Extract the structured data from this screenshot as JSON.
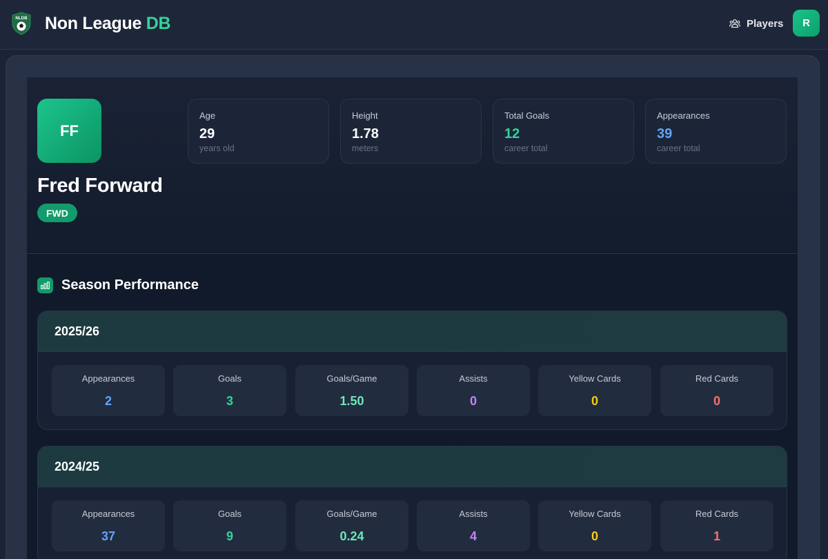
{
  "header": {
    "logo_text": "NLDB",
    "brand_main": "Non League",
    "brand_accent": "DB",
    "nav_players": "Players",
    "user_initial": "R"
  },
  "player": {
    "initials": "FF",
    "name": "Fred Forward",
    "position": "FWD",
    "stats": [
      {
        "label": "Age",
        "value": "29",
        "sub": "years old",
        "color": "#ffffff"
      },
      {
        "label": "Height",
        "value": "1.78",
        "sub": "meters",
        "color": "#ffffff"
      },
      {
        "label": "Total Goals",
        "value": "12",
        "sub": "career total",
        "color": "#34d399"
      },
      {
        "label": "Appearances",
        "value": "39",
        "sub": "career total",
        "color": "#60a5fa"
      }
    ]
  },
  "performance": {
    "title": "Season Performance",
    "seasons": [
      {
        "season": "2025/26",
        "stats": [
          {
            "label": "Appearances",
            "value": "2",
            "color": "#60a5fa"
          },
          {
            "label": "Goals",
            "value": "3",
            "color": "#34d399"
          },
          {
            "label": "Goals/Game",
            "value": "1.50",
            "color": "#6ee7b7"
          },
          {
            "label": "Assists",
            "value": "0",
            "color": "#c084fc"
          },
          {
            "label": "Yellow Cards",
            "value": "0",
            "color": "#facc15"
          },
          {
            "label": "Red Cards",
            "value": "0",
            "color": "#f87171"
          }
        ]
      },
      {
        "season": "2024/25",
        "stats": [
          {
            "label": "Appearances",
            "value": "37",
            "color": "#60a5fa"
          },
          {
            "label": "Goals",
            "value": "9",
            "color": "#34d399"
          },
          {
            "label": "Goals/Game",
            "value": "0.24",
            "color": "#6ee7b7"
          },
          {
            "label": "Assists",
            "value": "4",
            "color": "#c084fc"
          },
          {
            "label": "Yellow Cards",
            "value": "0",
            "color": "#facc15"
          },
          {
            "label": "Red Cards",
            "value": "1",
            "color": "#f87171"
          }
        ]
      }
    ]
  }
}
